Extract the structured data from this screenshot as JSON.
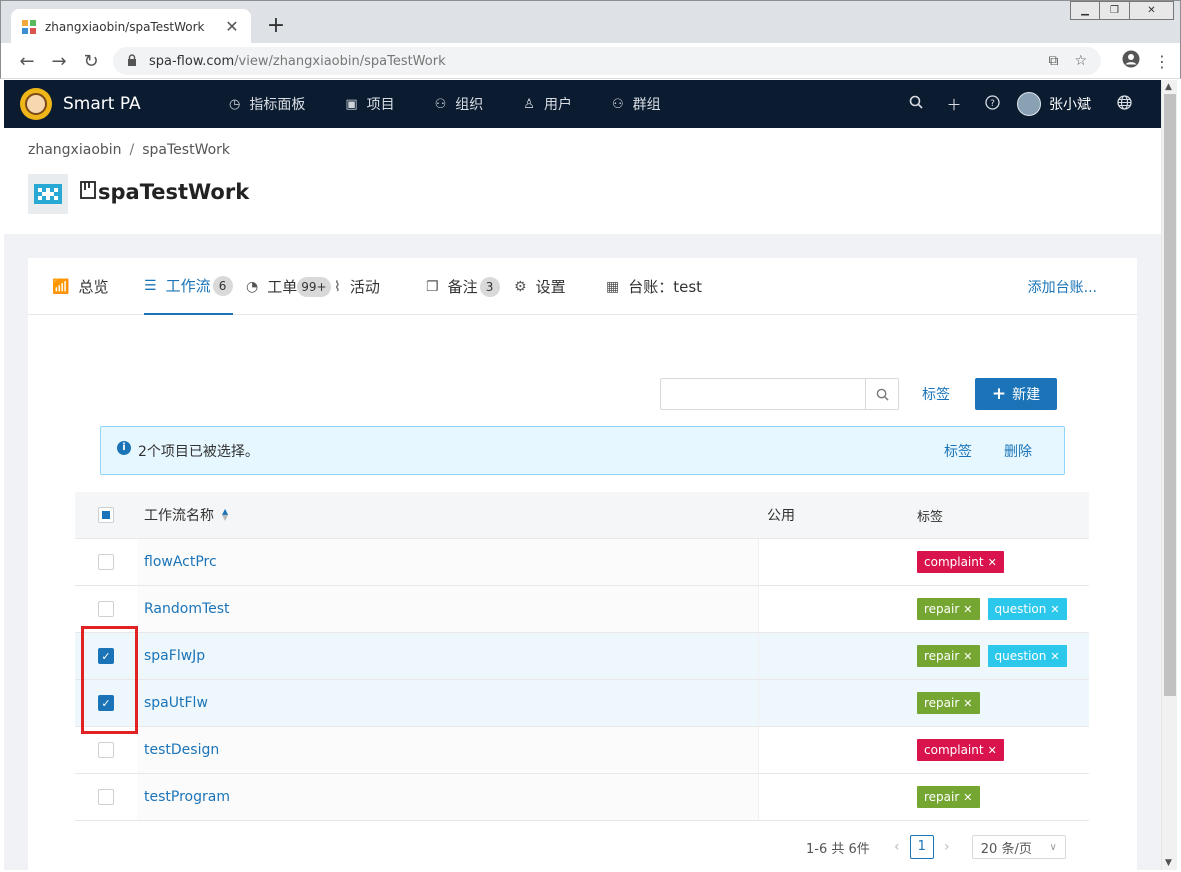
{
  "browser": {
    "tab_title": "zhangxiaobin/spaTestWork",
    "url_host": "spa-flow.com",
    "url_path": "/view/zhangxiaobin/spaTestWork"
  },
  "app": {
    "name": "Smart PA",
    "nav": [
      {
        "label": "指标面板",
        "icon": "dashboard-icon"
      },
      {
        "label": "项目",
        "icon": "project-icon"
      },
      {
        "label": "组织",
        "icon": "organization-icon"
      },
      {
        "label": "用户",
        "icon": "user-icon"
      },
      {
        "label": "群组",
        "icon": "group-icon"
      }
    ],
    "user_name": "张小斌"
  },
  "page": {
    "breadcrumb": [
      "zhangxiaobin",
      "spaTestWork"
    ],
    "title": "spaTestWork"
  },
  "tabs": [
    {
      "label": "总览",
      "badge": ""
    },
    {
      "label": "工作流",
      "badge": "6"
    },
    {
      "label": "工单",
      "badge": "99+"
    },
    {
      "label": "活动",
      "badge": ""
    },
    {
      "label": "备注",
      "badge": "3"
    },
    {
      "label": "设置",
      "badge": ""
    },
    {
      "label": "台账：test",
      "badge": ""
    }
  ],
  "tab_add_label": "添加台账...",
  "toolbar": {
    "search_placeholder": "",
    "tag_label": "标签",
    "new_label": "新建"
  },
  "selection_bar": {
    "text": "2个项目已被选择。",
    "tag_action": "标签",
    "delete_action": "删除"
  },
  "table": {
    "columns": {
      "name": "工作流名称",
      "public": "公用",
      "tags": "标签"
    },
    "rows": [
      {
        "name": "flowActPrc",
        "public": "",
        "checked": false,
        "tags": [
          {
            "text": "complaint",
            "color": "#d9134b"
          }
        ]
      },
      {
        "name": "RandomTest",
        "public": "",
        "checked": false,
        "tags": [
          {
            "text": "repair",
            "color": "#75a631"
          },
          {
            "text": "question",
            "color": "#2cc8ec"
          }
        ]
      },
      {
        "name": "spaFlwJp",
        "public": "",
        "checked": true,
        "tags": [
          {
            "text": "repair",
            "color": "#75a631"
          },
          {
            "text": "question",
            "color": "#2cc8ec"
          }
        ]
      },
      {
        "name": "spaUtFlw",
        "public": "",
        "checked": true,
        "tags": [
          {
            "text": "repair",
            "color": "#75a631"
          }
        ]
      },
      {
        "name": "testDesign",
        "public": "",
        "checked": false,
        "tags": [
          {
            "text": "complaint",
            "color": "#d9134b"
          }
        ]
      },
      {
        "name": "testProgram",
        "public": "",
        "checked": false,
        "tags": [
          {
            "text": "repair",
            "color": "#75a631"
          }
        ]
      }
    ]
  },
  "pagination": {
    "summary": "1-6 共 6件",
    "current_page": "1",
    "page_size": "20 条/页"
  }
}
